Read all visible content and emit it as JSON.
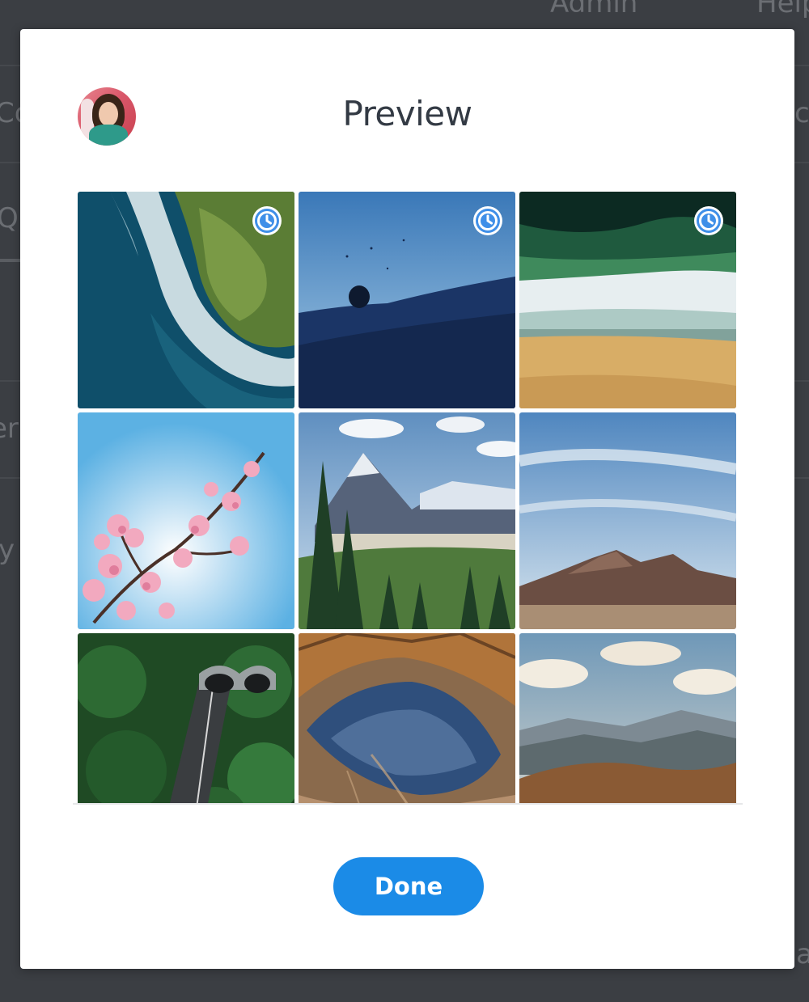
{
  "background": {
    "fragments": [
      "Admin",
      "Help",
      "Co",
      "Qu",
      "er",
      "y",
      "c",
      "ac"
    ]
  },
  "modal": {
    "title": "Preview",
    "done_label": "Done"
  },
  "photos": [
    {
      "name": "coast-aerial",
      "scheduled": true
    },
    {
      "name": "ocean-swimmer",
      "scheduled": true
    },
    {
      "name": "beach-waves-aerial",
      "scheduled": true
    },
    {
      "name": "cherry-blossom",
      "scheduled": false
    },
    {
      "name": "mountain-forest",
      "scheduled": false
    },
    {
      "name": "desert-mountain",
      "scheduled": false
    },
    {
      "name": "forest-tunnel-road",
      "scheduled": false
    },
    {
      "name": "crater-aerial",
      "scheduled": false
    },
    {
      "name": "mountain-valley",
      "scheduled": false
    }
  ],
  "colors": {
    "accent": "#1b8be7",
    "clock_badge": "#3f8fe8",
    "overlay": "#3b3e43"
  },
  "icons": {
    "scheduled": "clock-icon"
  }
}
